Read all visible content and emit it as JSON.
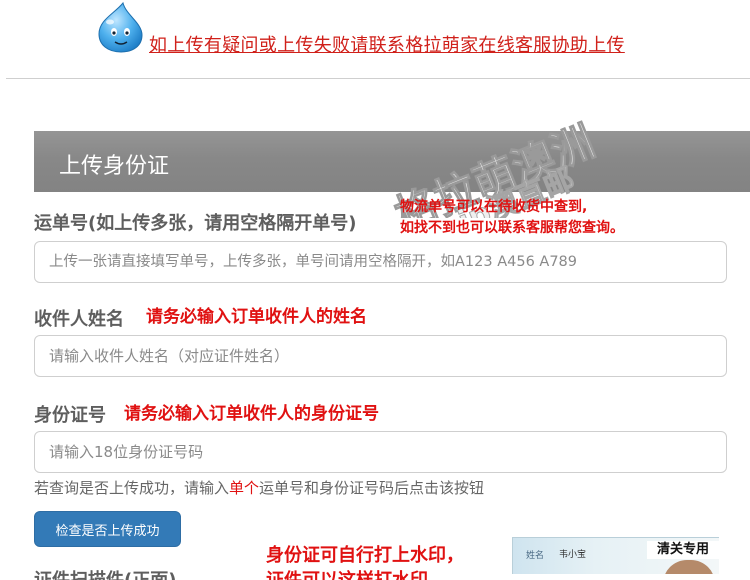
{
  "notice": {
    "text": "如上传有疑问或上传失败请联系格拉萌家在线客服协助上传",
    "logo_icon": "water-drop-mascot-icon"
  },
  "panel": {
    "title": "上传身份证"
  },
  "watermark": {
    "line1": "格拉萌澳洲",
    "line2": "jp澳直邮"
  },
  "tracking": {
    "label": "运单号(如上传多张，请用空格隔开单号)",
    "note_line1": "物流单号可以在待收货中查到,",
    "note_line2": "如找不到也可以联系客服帮您查询。",
    "placeholder": "上传一张请直接填写单号，上传多张，单号间请用空格隔开，如A123 A456 A789"
  },
  "recipient": {
    "label": "收件人姓名",
    "note": "请务必输入订单收件人的姓名",
    "placeholder": "请输入收件人姓名（对应证件姓名）"
  },
  "id_number": {
    "label": "身份证号",
    "note": "请务必输入订单收件人的身份证号",
    "placeholder": "请输入18位身份证号码"
  },
  "check": {
    "help_prefix": "若查询是否上传成功，请输入",
    "help_emphasis": "单个",
    "help_suffix": "运单号和身份证号码后点击该按钮",
    "button_label": "检查是否上传成功"
  },
  "bottom": {
    "watermark_note": "身份证可自行打上水印，",
    "cut_left": "证件扫描件(正面)",
    "cut_right": "证件可以这样打水印"
  },
  "id_card": {
    "field_label": "姓名",
    "name": "韦小宝",
    "stamp": "清关专用"
  },
  "colors": {
    "accent_red": "#e01111",
    "header_gray": "#8a8a8a",
    "button_blue": "#337ab7"
  }
}
